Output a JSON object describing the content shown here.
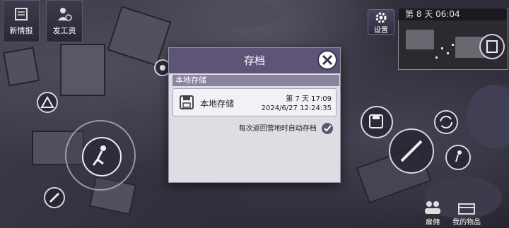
{
  "hud": {
    "news_label": "新情报",
    "salary_label": "发工资",
    "settings_label": "设置",
    "day_time": "第 8 天  06:04",
    "hire_label": "雇佣",
    "items_label": "我的物品"
  },
  "modal": {
    "title": "存档",
    "section_label": "本地存储",
    "slot": {
      "name": "本地存储",
      "day_time": "第 7 天  17:09",
      "datetime": "2024/6/27 12:24:35"
    },
    "autosave_label": "每次返回营地时自动存档",
    "autosave_checked": true
  },
  "colors": {
    "modal_header": "#5e5478",
    "section_bar": "#8a84a0",
    "modal_bg": "#dedde3"
  }
}
